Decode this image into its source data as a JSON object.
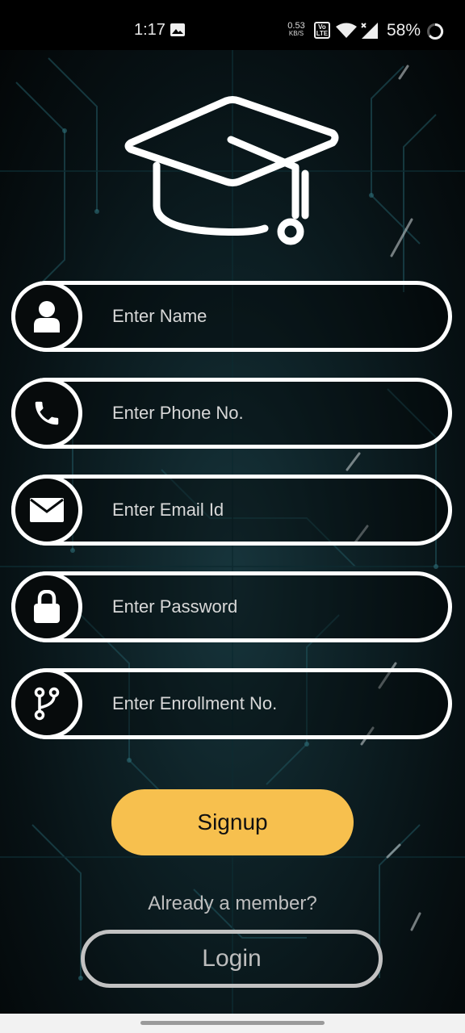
{
  "status_bar": {
    "time": "1:17",
    "net_speed_value": "0.53",
    "net_speed_unit": "KB/S",
    "volte_label": "Vo LTE",
    "battery_percent": "58%"
  },
  "form": {
    "name_placeholder": "Enter Name",
    "phone_placeholder": "Enter Phone No.",
    "email_placeholder": "Enter Email Id",
    "password_placeholder": "Enter Password",
    "enrollment_placeholder": "Enter Enrollment No."
  },
  "actions": {
    "signup_label": "Signup",
    "member_text": "Already a member?",
    "login_label": "Login"
  },
  "colors": {
    "accent": "#f7c04e",
    "field_border": "#ffffff",
    "login_border": "#c2c2c2"
  }
}
